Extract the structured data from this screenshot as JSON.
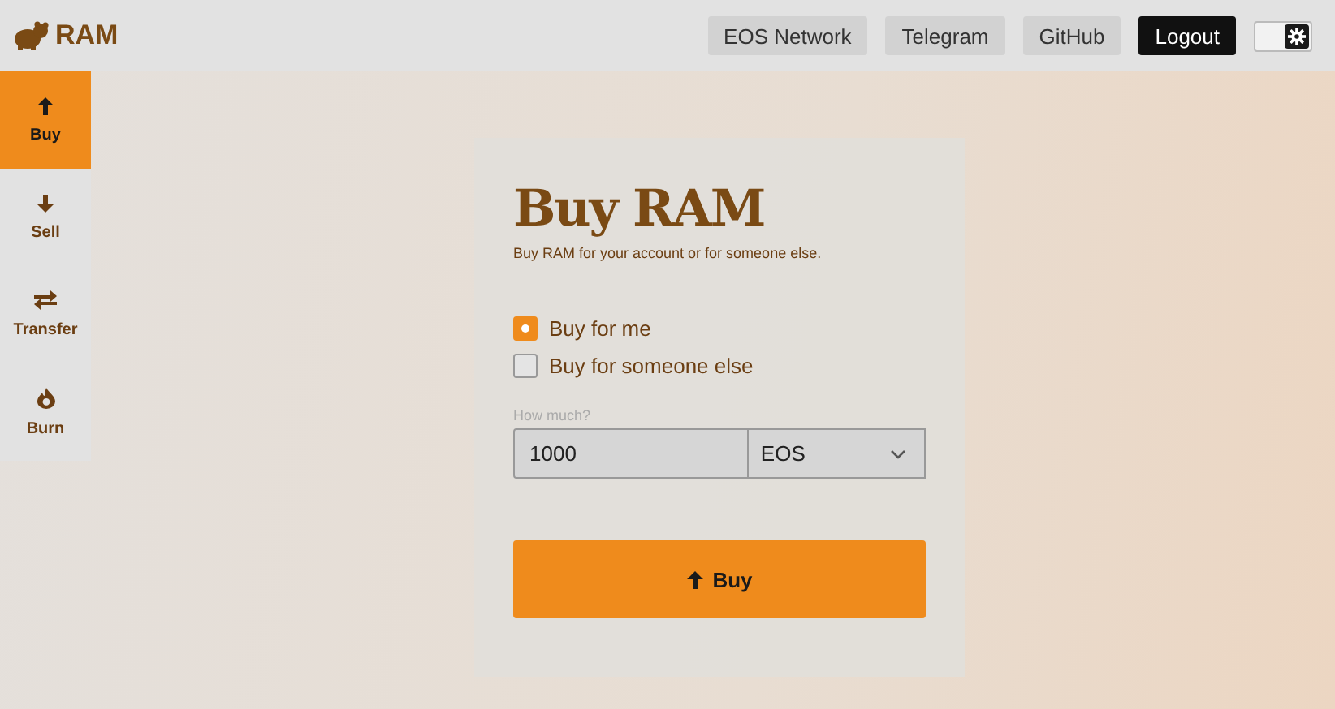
{
  "header": {
    "logo": "RAM",
    "links": [
      {
        "label": "EOS Network",
        "kind": "link"
      },
      {
        "label": "Telegram",
        "kind": "link"
      },
      {
        "label": "GitHub",
        "kind": "link"
      },
      {
        "label": "Logout",
        "kind": "primary"
      }
    ],
    "theme_toggle": {
      "on": true
    }
  },
  "sidebar": {
    "items": [
      {
        "label": "Buy",
        "kind": "buy",
        "selected": true
      },
      {
        "label": "Sell",
        "kind": "sell",
        "selected": false
      },
      {
        "label": "Transfer",
        "kind": "transfer",
        "selected": false
      },
      {
        "label": "Burn",
        "kind": "burn",
        "selected": false
      }
    ]
  },
  "form": {
    "title": "Buy RAM",
    "subtitle": "Buy RAM for your account or for someone else.",
    "options": [
      {
        "label": "Buy for me",
        "selected": true
      },
      {
        "label": "Buy for someone else",
        "selected": false
      }
    ],
    "amount": {
      "label": "How much?",
      "value": "1000",
      "unit": "EOS"
    },
    "submit": {
      "label": "Buy"
    }
  }
}
